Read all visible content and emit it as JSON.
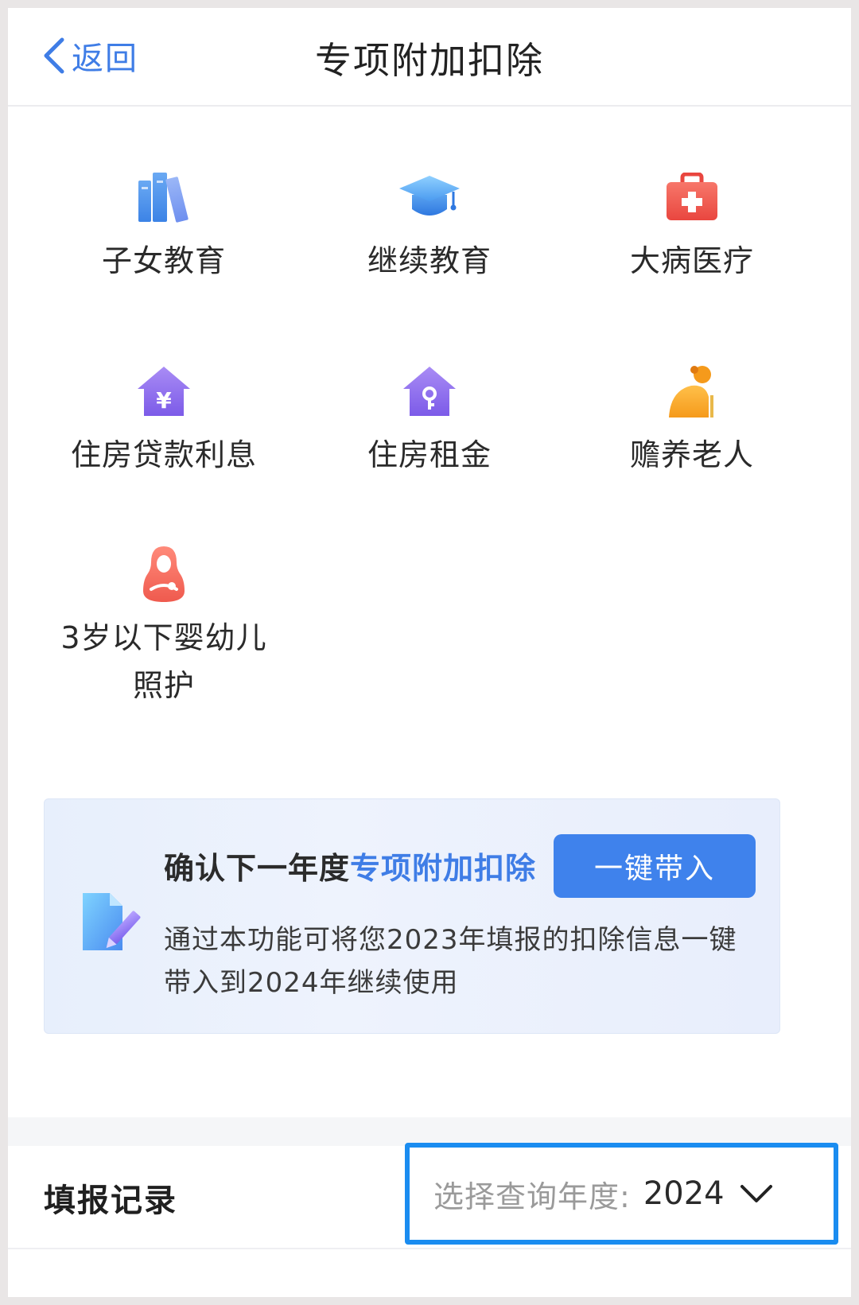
{
  "header": {
    "back_label": "返回",
    "title": "专项附加扣除"
  },
  "categories": [
    {
      "label": "子女教育",
      "icon": "books-icon"
    },
    {
      "label": "继续教育",
      "icon": "graduation-cap-icon"
    },
    {
      "label": "大病医疗",
      "icon": "medical-kit-icon"
    },
    {
      "label": "住房贷款利息",
      "icon": "house-yuan-icon"
    },
    {
      "label": "住房租金",
      "icon": "house-key-icon"
    },
    {
      "label": "赡养老人",
      "icon": "elderly-person-icon"
    },
    {
      "label": "3岁以下婴幼儿照护",
      "icon": "mother-baby-icon"
    }
  ],
  "promo": {
    "title_prefix": "确认下一年度",
    "title_highlight": "专项附加扣除",
    "button_label": "一键带入",
    "description": "通过本功能可将您2023年填报的扣除信息一键带入到2024年继续使用"
  },
  "records": {
    "title": "填报记录",
    "year_prompt": "选择查询年度:",
    "year_value": "2024"
  },
  "colors": {
    "accent": "#3f7de6",
    "button": "#3f82ec",
    "highlight_border": "#1a8cf0"
  }
}
